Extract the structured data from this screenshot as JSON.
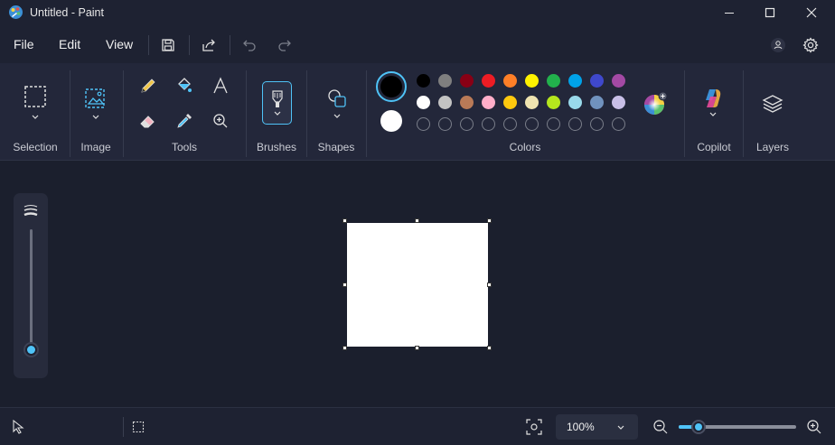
{
  "window": {
    "title": "Untitled - Paint"
  },
  "menu": {
    "file": "File",
    "edit": "Edit",
    "view": "View"
  },
  "ribbon": {
    "groups": {
      "selection": "Selection",
      "image": "Image",
      "tools": "Tools",
      "brushes": "Brushes",
      "shapes": "Shapes",
      "colors": "Colors",
      "copilot": "Copilot",
      "layers": "Layers"
    },
    "primary_color": "#000000",
    "secondary_color": "#ffffff",
    "palette_row1": [
      "#000000",
      "#7f7f7f",
      "#880015",
      "#ed1c24",
      "#ff7f27",
      "#fff200",
      "#22b14c",
      "#00a2e8",
      "#3f48cc",
      "#a349a4"
    ],
    "palette_row2": [
      "#ffffff",
      "#c3c3c3",
      "#b97a57",
      "#ffaec9",
      "#ffc90e",
      "#efe4b0",
      "#b5e61d",
      "#99d9ea",
      "#7092be",
      "#c8bfe7"
    ]
  },
  "brush_size": {
    "level": 0.05
  },
  "status": {
    "zoom": "100%",
    "zoom_level": 0.17
  }
}
